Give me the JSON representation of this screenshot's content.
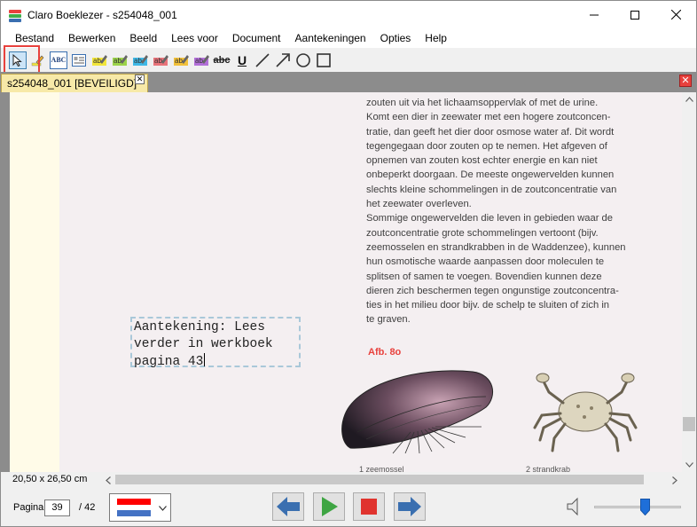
{
  "window": {
    "title": "Claro Boeklezer - s254048_001",
    "controls": [
      "minimize",
      "maximize",
      "close"
    ]
  },
  "menu": [
    "Bestand",
    "Bewerken",
    "Beeld",
    "Lees voor",
    "Document",
    "Aantekeningen",
    "Opties",
    "Help"
  ],
  "toolbar": {
    "abc_label": "ABC",
    "strike_label": "abc",
    "underline_label": "U",
    "highlight_colors": [
      "#f2e63a",
      "#9cd34a",
      "#3fb8e6",
      "#e8737a",
      "#f2c13a",
      "#b26fd8"
    ]
  },
  "tab": {
    "label": "s254048_001 [BEVEILIGD]*",
    "close_glyph": "✕"
  },
  "document": {
    "paragraph_lines": [
      "zouten uit via het lichaamsoppervlak of met de urine.",
      "Komt een dier in zeewater met een hogere zoutconcen-",
      "tratie, dan geeft het dier door osmose water af. Dit wordt",
      "tegengegaan door zouten op te nemen. Het afgeven of",
      "opnemen van zouten kost echter energie en kan niet",
      "onbeperkt doorgaan. De meeste ongewervelden kunnen",
      "slechts kleine schommelingen in de zoutconcentratie van",
      "het zeewater overleven.",
      "Sommige ongewervelden die leven in gebieden waar de",
      "zoutconcentratie grote schommelingen vertoont (bijv.",
      "zeemosselen en strandkrabben in de Waddenzee), kunnen",
      "hun osmotische waarde aanpassen door moleculen te",
      "splitsen of samen te voegen. Bovendien kunnen deze",
      "dieren zich beschermen tegen ongunstige zoutconcentra-",
      "ties in het milieu door bijv. de schelp te sluiten of zich in",
      "te graven."
    ],
    "annotation_lines": [
      "Aantekening: Lees",
      "verder in werkboek",
      "pagina 43"
    ],
    "figure_label": "Afb. 8o",
    "caption_left": "1   zeemossel",
    "caption_right": "2   strandkrab"
  },
  "status": {
    "page_size": "20,50 x 26,50 cm"
  },
  "navigation": {
    "page_label": "Pagina",
    "current_page": "39",
    "total_pages": "/ 42",
    "flag_colors": [
      "#ff0000",
      "#ffffff",
      "#4472c4"
    ],
    "volume_level": 0.55
  },
  "colors": {
    "accent_red": "#e8413d",
    "tab_yellow": "#f7e9a8",
    "nav_blue": "#3a6fb0",
    "play_green": "#3ea543",
    "stop_red": "#e0332e"
  }
}
